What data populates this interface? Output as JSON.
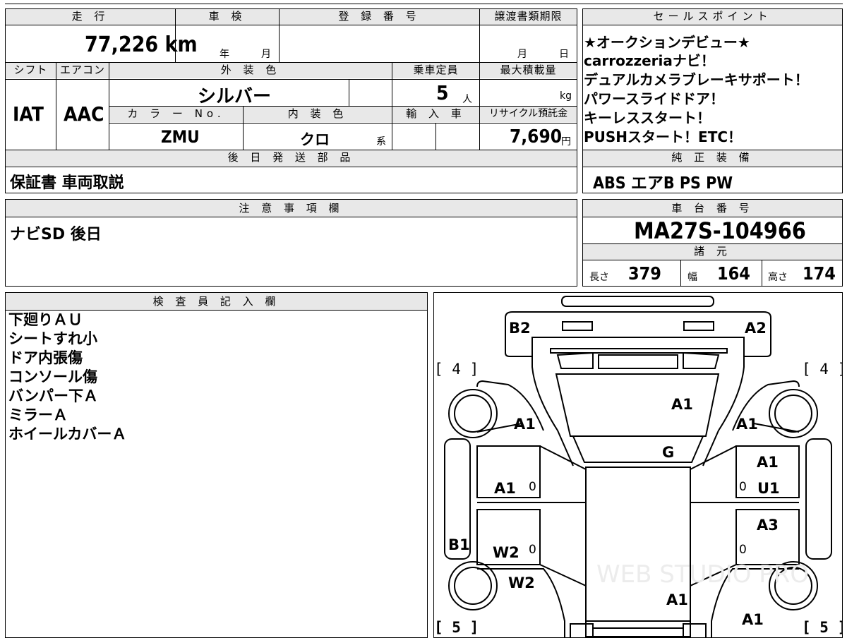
{
  "headers": {
    "mileage": "走 行",
    "inspection": "車 検",
    "registration": "登 録 番 号",
    "transfer_deadline": "譲渡書類期限",
    "sales_points": "セールスポイント",
    "shift": "シフト",
    "aircon": "エアコン",
    "exterior_color": "外 装 色",
    "capacity": "乗車定員",
    "max_load": "最大積載量",
    "color_no": "カ ラ ー No.",
    "interior_color": "内 装 色",
    "import": "輸 入 車",
    "recycle_fee": "リサイクル預託金",
    "later_parts": "後 日 発 送 部 品",
    "standard_equipment": "純 正 装 備",
    "notes": "注 意 事 項 欄",
    "chassis_number": "車 台 番 号",
    "specs": "諸 元",
    "inspector_notes": "検 査 員 記 入 欄"
  },
  "values": {
    "mileage": "77,226 km",
    "inspection_year_unit": "年",
    "inspection_month_unit": "月",
    "deadline_month_unit": "月",
    "deadline_day_unit": "日",
    "shift": "IAT",
    "aircon": "AAC",
    "exterior_color": "シルバー",
    "capacity": "5",
    "capacity_unit": "人",
    "max_load_unit": "kg",
    "color_no": "ZMU",
    "interior_color": "クロ",
    "interior_suffix": "系",
    "recycle_fee": "7,690",
    "recycle_fee_unit": "円",
    "later_parts": "保証書 車両取説",
    "standard_equipment": "ABS エアB PS PW",
    "notes": "ナビSD 後日",
    "chassis_number": "MA27S-104966",
    "length_label": "長さ",
    "length": "379",
    "width_label": "幅",
    "width": "164",
    "height_label": "高さ",
    "height": "174"
  },
  "sales_points": [
    "★オークションデビュー★",
    "carrozzeriaナビ！",
    "デュアルカメラブレーキサポート！",
    "パワースライドドア！",
    "キーレススタート！",
    "PUSHスタート！ETC！"
  ],
  "inspector_notes": [
    "下廻りＡＵ",
    "シートすれ小",
    "ドア内張傷",
    "コンソール傷",
    "バンパー下Ａ",
    "ミラーＡ",
    "ホイールカバーＡ"
  ],
  "diagram": {
    "marks": [
      "B2",
      "A2",
      "A1",
      "A1",
      "A1",
      "G",
      "A1",
      "A1",
      "U1",
      "A3",
      "B1",
      "W2",
      "W2",
      "A1",
      "A1"
    ],
    "brackets": [
      "[ 4 ]",
      "[ 4 ]",
      "[ 5 ]",
      "[ 5 ]"
    ],
    "zeros": [
      "0",
      "0",
      "0",
      "0"
    ],
    "watermark": "WEB STUDIO PRO"
  }
}
